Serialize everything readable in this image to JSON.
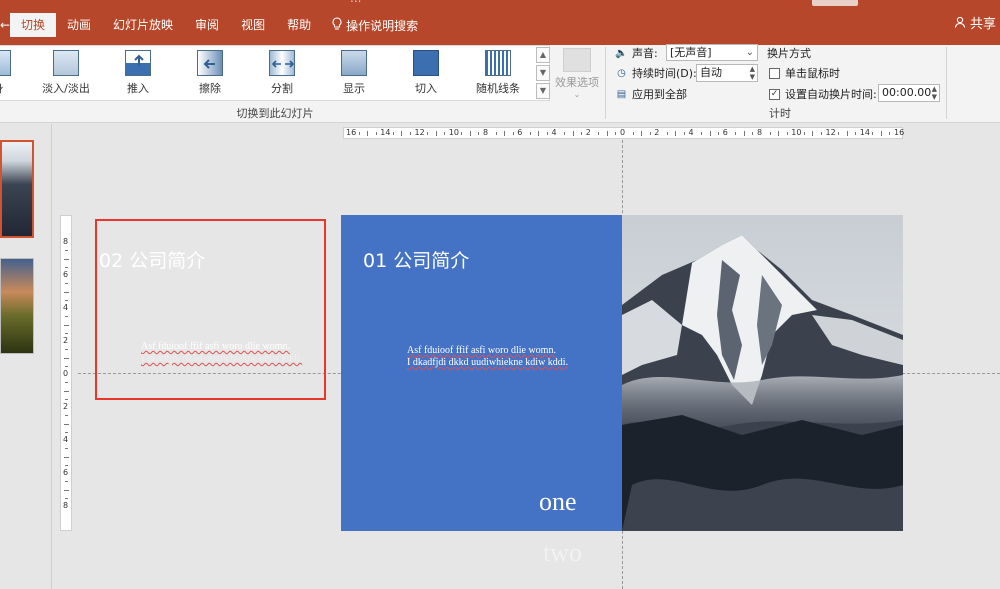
{
  "window": {
    "title": "..."
  },
  "tabs": [
    {
      "label": "切换",
      "active": true
    },
    {
      "label": "动画",
      "active": false
    },
    {
      "label": "幻灯片放映",
      "active": false
    },
    {
      "label": "审阅",
      "active": false
    },
    {
      "label": "视图",
      "active": false
    },
    {
      "label": "帮助",
      "active": false
    }
  ],
  "tell_me": {
    "label": "操作说明搜索",
    "icon": "lightbulb-icon"
  },
  "share": {
    "label": "共享",
    "icon": "person-icon"
  },
  "ribbon": {
    "transitions": [
      {
        "label": "淡入/淡出",
        "icon": "fade-icon"
      },
      {
        "label": "推入",
        "icon": "push-icon"
      },
      {
        "label": "擦除",
        "icon": "wipe-icon"
      },
      {
        "label": "分割",
        "icon": "split-icon"
      },
      {
        "label": "显示",
        "icon": "reveal-icon"
      },
      {
        "label": "切入",
        "icon": "cut-icon"
      },
      {
        "label": "随机线条",
        "icon": "random-bars-icon"
      }
    ],
    "effect_options_label": "效果选项",
    "group_transitions_label": "切换到此幻灯片",
    "sound_label": "声音:",
    "sound_value": "[无声音]",
    "duration_label": "持续时间(D):",
    "duration_value": "自动",
    "apply_all_label": "应用到全部",
    "advance_label": "换片方式",
    "on_click_label": "单击鼠标时",
    "on_click_checked": false,
    "after_label": "设置自动换片时间:",
    "after_checked": true,
    "after_value": "00:00.00",
    "group_timing_label": "计时"
  },
  "ruler": {
    "h_numbers": [
      "16",
      "14",
      "12",
      "10",
      "8",
      "6",
      "4",
      "2",
      "0",
      "2",
      "4",
      "6",
      "8",
      "10",
      "12",
      "14",
      "16"
    ],
    "v_numbers": [
      "8",
      "6",
      "4",
      "2",
      "0",
      "2",
      "4",
      "6",
      "8"
    ]
  },
  "slide": {
    "title_1": "01 公司简介",
    "body_1": [
      "Asf  fduioof  ffif asfi woro dlie womn.",
      "I dkadfjdi dkkd uudiwhiekne kdiw kddi."
    ],
    "word_one": "one",
    "title_2": "02 公司简介",
    "body_2": [
      "Asf  fduioof  ffif asfi woro dlie womn.",
      "I dkadfjdi dkkd uudiwhiekne kdiw kddi."
    ],
    "word_two": "two"
  }
}
